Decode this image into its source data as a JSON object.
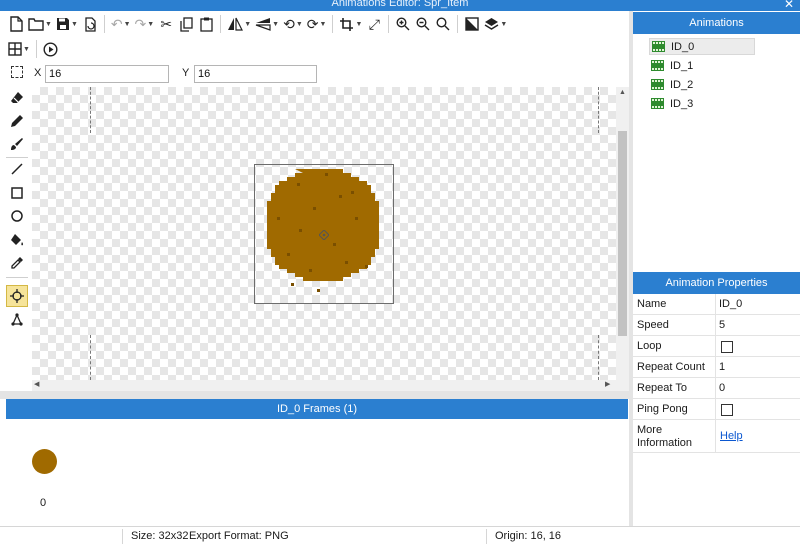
{
  "window": {
    "title": "Animations Editor: Spr_Item",
    "close": "✕"
  },
  "toolbar": {
    "icons": [
      "new-file-icon",
      "open-folder-icon",
      "save-icon",
      "export-icon",
      "undo-icon",
      "redo-icon",
      "cut-icon",
      "copy-icon",
      "paste-icon",
      "flip-horizontal-icon",
      "flip-vertical-icon",
      "rotate-left-icon",
      "rotate-right-icon",
      "crop-icon",
      "resize-icon",
      "zoom-in-icon",
      "zoom-out-icon",
      "zoom-reset-icon",
      "grayscale-icon",
      "layers-icon",
      "grid-icon",
      "play-icon"
    ]
  },
  "coords": {
    "x_label": "X",
    "x_value": "16",
    "y_label": "Y",
    "y_value": "16"
  },
  "tools": [
    "eraser-icon",
    "pencil-icon",
    "brush-icon",
    "line-icon",
    "rectangle-icon",
    "ellipse-icon",
    "fill-bucket-icon",
    "eyedropper-icon",
    "origin-icon",
    "skeleton-icon"
  ],
  "frames": {
    "header": "ID_0 Frames (1)",
    "items": [
      {
        "index": "0"
      }
    ]
  },
  "animations": {
    "header": "Animations",
    "items": [
      {
        "label": "ID_0"
      },
      {
        "label": "ID_1"
      },
      {
        "label": "ID_2"
      },
      {
        "label": "ID_3"
      }
    ],
    "selected": "ID_0"
  },
  "properties": {
    "header": "Animation Properties",
    "rows": {
      "name": {
        "label": "Name",
        "value": "ID_0"
      },
      "speed": {
        "label": "Speed",
        "value": "5"
      },
      "loop": {
        "label": "Loop"
      },
      "repeat_count": {
        "label": "Repeat Count",
        "value": "1"
      },
      "repeat_to": {
        "label": "Repeat To",
        "value": "0"
      },
      "ping_pong": {
        "label": "Ping Pong"
      },
      "more_info": {
        "label": "More Information",
        "link": "Help"
      }
    }
  },
  "status": {
    "size": "Size: 32x32",
    "export_format": "Export Format: PNG",
    "origin": "Origin: 16, 16"
  },
  "colors": {
    "accent": "#2b7fd0",
    "sprite": "#a06a00",
    "sprite_dots": "#7a4f00"
  }
}
